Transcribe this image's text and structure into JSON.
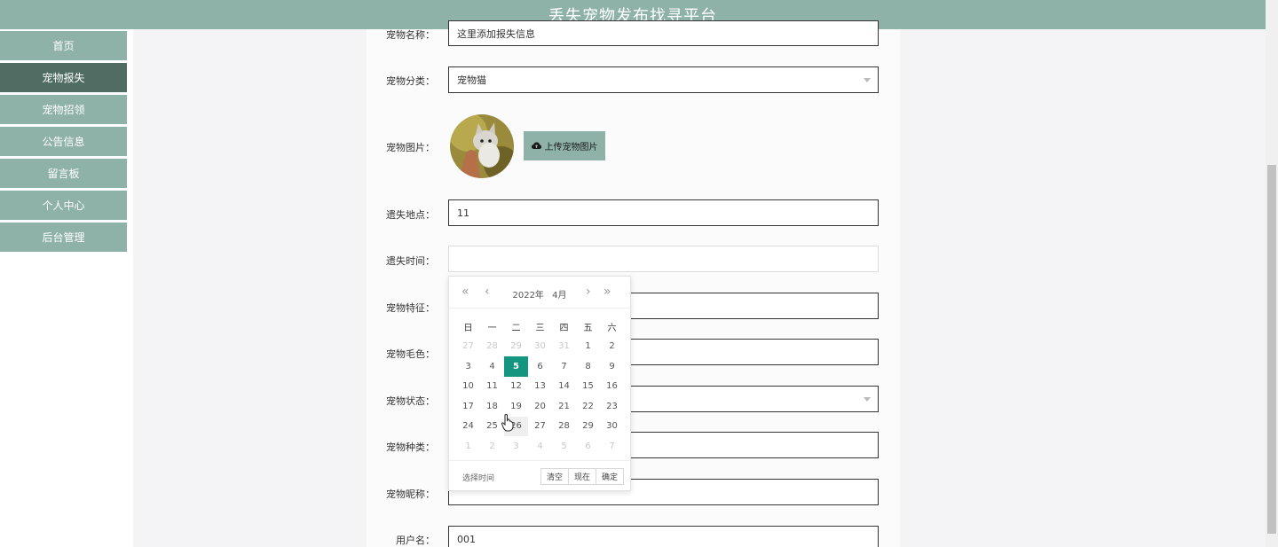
{
  "header": {
    "title": "丢失宠物发布找寻平台"
  },
  "sidebar": {
    "items": [
      {
        "label": "首页",
        "active": false
      },
      {
        "label": "宠物报失",
        "active": true
      },
      {
        "label": "宠物招领",
        "active": false
      },
      {
        "label": "公告信息",
        "active": false
      },
      {
        "label": "留言板",
        "active": false
      },
      {
        "label": "个人中心",
        "active": false
      },
      {
        "label": "后台管理",
        "active": false
      }
    ]
  },
  "form": {
    "pet_name": {
      "label": "宠物名称：",
      "value": "这里添加报失信息"
    },
    "category": {
      "label": "宠物分类：",
      "value": "宠物猫"
    },
    "image": {
      "label": "宠物图片：",
      "upload_label": "上传宠物图片"
    },
    "lost_place": {
      "label": "遗失地点：",
      "value": "11"
    },
    "lost_time": {
      "label": "遗失时间：",
      "value": ""
    },
    "features": {
      "label": "宠物特征："
    },
    "fur_color": {
      "label": "宠物毛色："
    },
    "status": {
      "label": "宠物状态："
    },
    "breed": {
      "label": "宠物种类："
    },
    "nickname": {
      "label": "宠物昵称："
    },
    "username": {
      "label": "用户名：",
      "value": "001"
    }
  },
  "datepicker": {
    "year_label": "2022年",
    "month_label": "4月",
    "weekdays": [
      "日",
      "一",
      "二",
      "三",
      "四",
      "五",
      "六"
    ],
    "weeks": [
      [
        "27",
        "28",
        "29",
        "30",
        "31",
        "1",
        "2"
      ],
      [
        "3",
        "4",
        "5",
        "6",
        "7",
        "8",
        "9"
      ],
      [
        "10",
        "11",
        "12",
        "13",
        "14",
        "15",
        "16"
      ],
      [
        "17",
        "18",
        "19",
        "20",
        "21",
        "22",
        "23"
      ],
      [
        "24",
        "25",
        "26",
        "27",
        "28",
        "29",
        "30"
      ],
      [
        "1",
        "2",
        "3",
        "4",
        "5",
        "6",
        "7"
      ]
    ],
    "selected_day": "5",
    "hover_day": "26",
    "footer_label": "选择时间",
    "buttons": {
      "clear": "清空",
      "now": "现在",
      "confirm": "确定"
    }
  },
  "colors": {
    "theme": "#8fb2a8",
    "active_nav": "#4f6d62",
    "selected_date": "#139580"
  }
}
